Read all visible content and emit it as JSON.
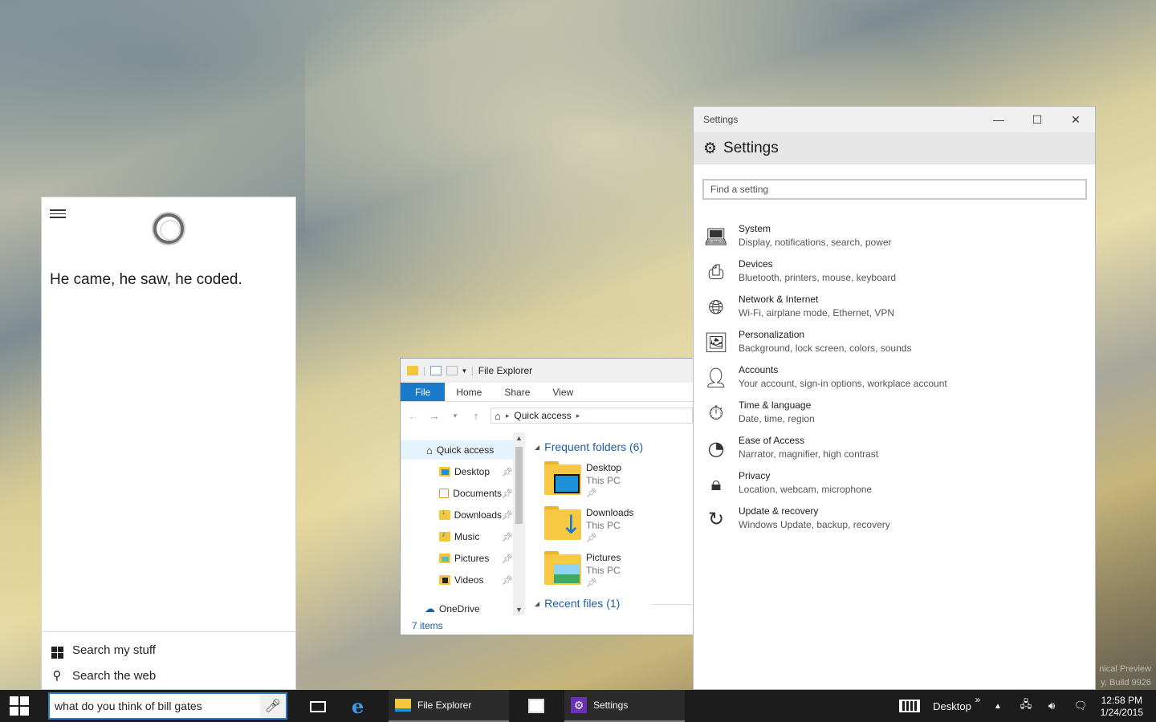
{
  "cortana": {
    "answer": "He came, he saw, he coded.",
    "search_my_stuff": "Search my stuff",
    "search_the_web": "Search the web"
  },
  "explorer": {
    "title": "File Explorer",
    "tabs": [
      "File",
      "Home",
      "Share",
      "View"
    ],
    "address": "Quick access",
    "nav": [
      {
        "label": "Quick access",
        "icon": "star-home-icon"
      },
      {
        "label": "Desktop",
        "icon": "desktop-folder-icon"
      },
      {
        "label": "Documents",
        "icon": "documents-folder-icon"
      },
      {
        "label": "Downloads",
        "icon": "downloads-folder-icon"
      },
      {
        "label": "Music",
        "icon": "music-folder-icon"
      },
      {
        "label": "Pictures",
        "icon": "pictures-folder-icon"
      },
      {
        "label": "Videos",
        "icon": "videos-folder-icon"
      },
      {
        "label": "OneDrive",
        "icon": "onedrive-cloud-icon"
      }
    ],
    "frequent_header": "Frequent folders (6)",
    "recent_header": "Recent files (1)",
    "folders": [
      {
        "name": "Desktop",
        "location": "This PC"
      },
      {
        "name": "Downloads",
        "location": "This PC"
      },
      {
        "name": "Pictures",
        "location": "This PC"
      }
    ],
    "status": "7 items"
  },
  "settings": {
    "window_title": "Settings",
    "header": "Settings",
    "search_placeholder": "Find a setting",
    "categories": [
      {
        "title": "System",
        "subtitle": "Display, notifications, search, power",
        "icon": "laptop-icon"
      },
      {
        "title": "Devices",
        "subtitle": "Bluetooth, printers, mouse, keyboard",
        "icon": "devices-icon"
      },
      {
        "title": "Network & Internet",
        "subtitle": "Wi-Fi, airplane mode, Ethernet, VPN",
        "icon": "globe-icon"
      },
      {
        "title": "Personalization",
        "subtitle": "Background, lock screen, colors, sounds",
        "icon": "personalization-icon"
      },
      {
        "title": "Accounts",
        "subtitle": "Your account, sign-in options, workplace account",
        "icon": "person-icon"
      },
      {
        "title": "Time & language",
        "subtitle": "Date, time, region",
        "icon": "time-language-icon"
      },
      {
        "title": "Ease of Access",
        "subtitle": "Narrator, magnifier, high contrast",
        "icon": "ease-of-access-icon"
      },
      {
        "title": "Privacy",
        "subtitle": "Location, webcam, microphone",
        "icon": "lock-icon"
      },
      {
        "title": "Update & recovery",
        "subtitle": "Windows Update, backup, recovery",
        "icon": "refresh-icon"
      }
    ]
  },
  "taskbar": {
    "search_text": "what do you think of bill gates",
    "apps": [
      {
        "label": "File Explorer",
        "icon": "file-explorer-icon"
      },
      {
        "label": "Settings",
        "icon": "settings-gear-icon"
      }
    ],
    "desktop_toolbar": "Desktop",
    "desktop_chevron": "»",
    "time": "12:58 PM",
    "date": "1/24/2015"
  },
  "watermark": {
    "line1": "nical Preview",
    "line2": "y, Build 9926"
  }
}
